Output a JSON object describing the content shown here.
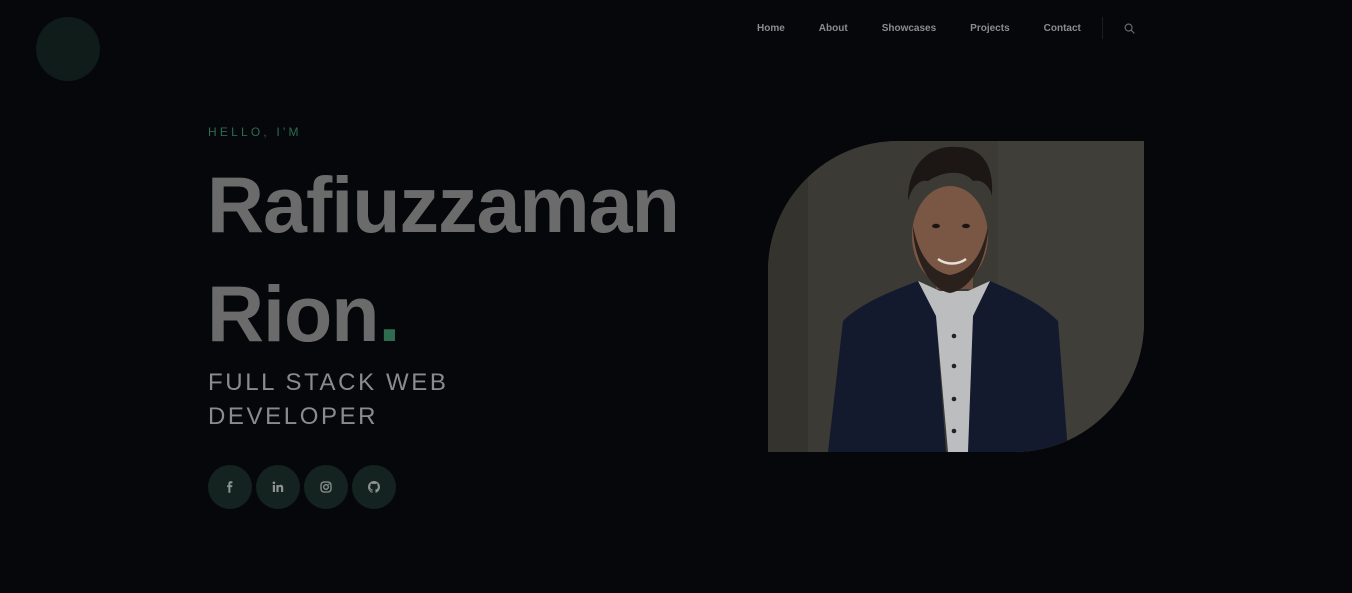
{
  "nav": {
    "items": [
      "Home",
      "About",
      "Showcases",
      "Projects",
      "Contact"
    ],
    "search_icon": "search-icon"
  },
  "hero": {
    "greeting": "HELLO, I'M",
    "name_line1": "Rafiuzzaman",
    "name_line2": "Rion",
    "name_dot": ".",
    "role": "FULL STACK WEB DEVELOPER",
    "photo_alt": "Rafiuzzaman Rion"
  },
  "socials": [
    {
      "icon": "facebook-icon"
    },
    {
      "icon": "linkedin-icon"
    },
    {
      "icon": "instagram-icon"
    },
    {
      "icon": "github-icon"
    }
  ],
  "colors": {
    "background": "#05070a",
    "accent": "#2e6b4f",
    "name_text": "#6b6b6b",
    "social_bg": "#14231f"
  }
}
